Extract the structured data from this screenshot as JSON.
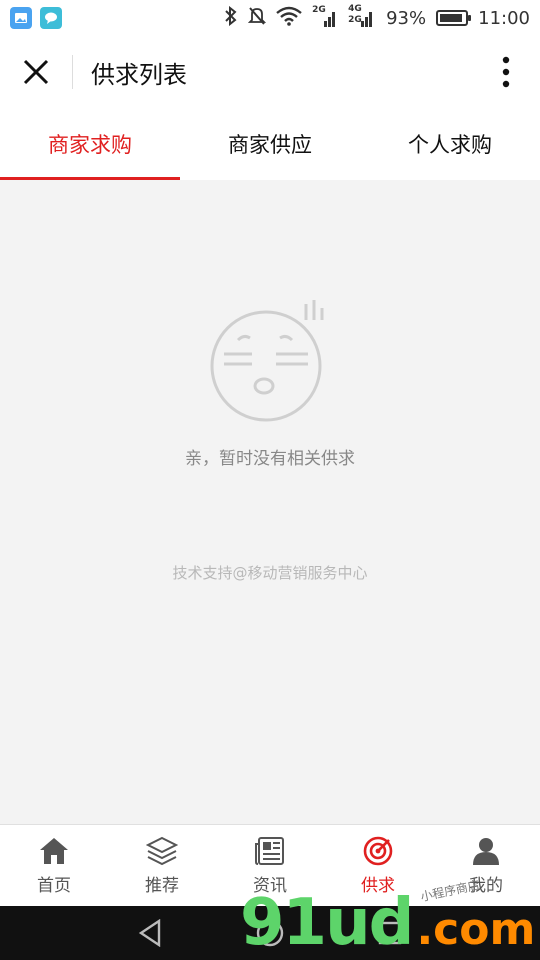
{
  "status_bar": {
    "network_1": "2G",
    "network_2_top": "4G",
    "network_2_bottom": "2G",
    "battery_percent": "93%",
    "battery_level": 0.93,
    "time": "11:00"
  },
  "header": {
    "title": "供求列表"
  },
  "tabs": [
    {
      "label": "商家求购",
      "active": true
    },
    {
      "label": "商家供应",
      "active": false
    },
    {
      "label": "个人求购",
      "active": false
    }
  ],
  "content": {
    "empty_message": "亲，暂时没有相关供求",
    "support_text": "技术支持@移动营销服务中心"
  },
  "tabbar": [
    {
      "label": "首页",
      "icon": "home-icon",
      "active": false
    },
    {
      "label": "推荐",
      "icon": "layers-icon",
      "active": false
    },
    {
      "label": "资讯",
      "icon": "news-icon",
      "active": false
    },
    {
      "label": "供求",
      "icon": "target-icon",
      "active": true
    },
    {
      "label": "我的",
      "icon": "user-icon",
      "active": false
    }
  ],
  "watermark": {
    "main": "91ud",
    "suffix": ".com",
    "small": "小程序商店"
  },
  "colors": {
    "accent": "#e02020",
    "background": "#f3f3f3",
    "watermark_green": "#5dd46a",
    "watermark_orange": "#ff8a00"
  }
}
